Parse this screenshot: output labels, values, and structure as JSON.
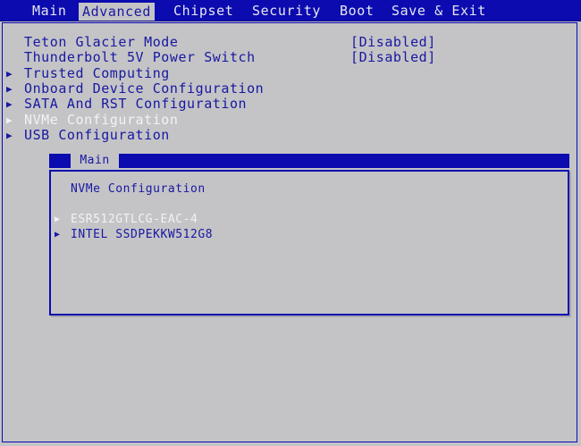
{
  "tabs": [
    {
      "label": "Main"
    },
    {
      "label": "Advanced"
    },
    {
      "label": "Chipset"
    },
    {
      "label": "Security"
    },
    {
      "label": "Boot"
    },
    {
      "label": "Save & Exit"
    }
  ],
  "active_tab": "Advanced",
  "settings": [
    {
      "label": "Teton Glacier Mode",
      "value": "[Disabled]"
    },
    {
      "label": "Thunderbolt 5V Power Switch",
      "value": "[Disabled]"
    }
  ],
  "submenus": [
    {
      "label": "Trusted Computing"
    },
    {
      "label": "Onboard Device Configuration"
    },
    {
      "label": "SATA And RST Configuration"
    },
    {
      "label": "NVMe Configuration"
    },
    {
      "label": "USB Configuration"
    }
  ],
  "popup": {
    "title": "Main",
    "heading": "NVMe Configuration",
    "devices": [
      {
        "label": "ESR512GTLCG-EAC-4"
      },
      {
        "label": "INTEL SSDPEKKW512G8"
      }
    ]
  },
  "icons": {
    "submenu_arrow": "triangle-right-icon"
  },
  "colors": {
    "background": "#c4c4c7",
    "bios_blue": "#0b0bb0",
    "text_blue": "#1818a0",
    "highlight_text": "#f2f2f6"
  }
}
